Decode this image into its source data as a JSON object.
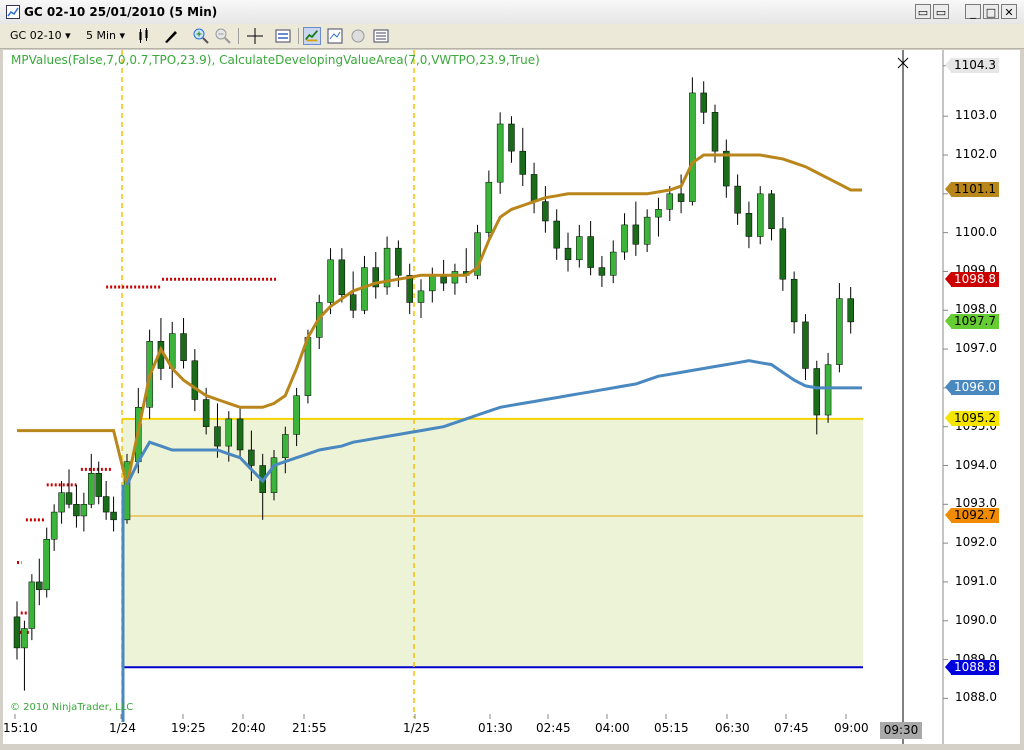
{
  "window": {
    "title": "GC 02-10  25/01/2010 (5 Min)",
    "buttons": [
      "▭",
      "▭",
      "_",
      "□",
      "✕"
    ]
  },
  "toolbar": {
    "instrument": "GC 02-10",
    "interval": "5 Min",
    "icons": [
      "bar-style-icon",
      "draw-tool-icon",
      "zoom-in-icon",
      "zoom-out-icon",
      "crosshair-icon",
      "properties-icon",
      "data-box-icon",
      "strategy-icon",
      "chart-trader-icon",
      "alert-icon",
      "chart-options-icon"
    ]
  },
  "chart": {
    "indicator_label": "MPValues(False,7,0,0.7,TPO,23.9), CalculateDevelopingValueArea(7,0,VWTPO,23.9,True)",
    "copyright": "© 2010 NinjaTrader, LLC",
    "crosshair_time": "09:30",
    "colors": {
      "up_candle": "#3cb43c",
      "down_candle": "#1a6b1a",
      "vwap": "#b8861a",
      "poc": "#4a88c0",
      "value_area_fill": "#edf3d6",
      "value_area_high": "#f5d200",
      "mid_line": "#e8a000",
      "low_line": "#0000cc",
      "session_divider": "#f5c000",
      "level_dots": "#cc0000"
    }
  },
  "chart_data": {
    "type": "candlestick",
    "title": "GC 02-10 (5 Min)",
    "y_ticks": [
      "1104.3",
      "1103.0",
      "1102.0",
      "1101.0",
      "1100.0",
      "1099.0",
      "1098.0",
      "1097.0",
      "1096.0",
      "1095.0",
      "1094.0",
      "1093.0",
      "1092.0",
      "1091.0",
      "1090.0",
      "1089.0",
      "1088.0"
    ],
    "x_ticks": [
      "15:10",
      "1/24",
      "19:25",
      "20:40",
      "21:55",
      "1/25",
      "01:30",
      "02:45",
      "04:00",
      "05:15",
      "06:30",
      "07:45",
      "09:00"
    ],
    "ylim": [
      1087.7,
      1104.5
    ],
    "price_tags": [
      {
        "label": "1104.3",
        "value": 1104.3,
        "color": "#e6e6e6",
        "text": "#000000"
      },
      {
        "label": "1101.1",
        "value": 1101.1,
        "color": "#b8861a",
        "text": "#000000"
      },
      {
        "label": "1098.8",
        "value": 1098.8,
        "color": "#cc0000",
        "text": "#ffffff"
      },
      {
        "label": "1097.7",
        "value": 1097.7,
        "color": "#66cc33",
        "text": "#000000"
      },
      {
        "label": "1096.0",
        "value": 1096.0,
        "color": "#4a88c0",
        "text": "#ffffff"
      },
      {
        "label": "1095.2",
        "value": 1095.2,
        "color": "#f5e400",
        "text": "#000000"
      },
      {
        "label": "1092.7",
        "value": 1092.7,
        "color": "#f08a00",
        "text": "#000000"
      },
      {
        "label": "1088.8",
        "value": 1088.8,
        "color": "#0000dd",
        "text": "#ffffff"
      }
    ],
    "levels": {
      "value_area_high": 1095.2,
      "mid": 1092.7,
      "value_area_low": 1088.8
    },
    "candles": [
      [
        1090.1,
        1090.5,
        1089.0,
        1089.3
      ],
      [
        1089.3,
        1090.0,
        1088.2,
        1089.8
      ],
      [
        1089.8,
        1091.2,
        1089.5,
        1091.0
      ],
      [
        1091.0,
        1091.6,
        1090.4,
        1090.8
      ],
      [
        1090.8,
        1092.4,
        1090.6,
        1092.1
      ],
      [
        1092.1,
        1093.0,
        1091.8,
        1092.8
      ],
      [
        1092.8,
        1093.6,
        1092.5,
        1093.3
      ],
      [
        1093.3,
        1093.9,
        1092.9,
        1093.0
      ],
      [
        1093.0,
        1093.5,
        1092.4,
        1092.7
      ],
      [
        1092.7,
        1093.3,
        1092.3,
        1093.0
      ],
      [
        1093.0,
        1094.3,
        1092.9,
        1093.8
      ],
      [
        1093.8,
        1094.1,
        1093.0,
        1093.2
      ],
      [
        1093.2,
        1093.6,
        1092.6,
        1092.8
      ],
      [
        1092.8,
        1093.2,
        1092.3,
        1092.6
      ],
      [
        1092.6,
        1094.3,
        1092.5,
        1094.1
      ],
      [
        1094.1,
        1096.0,
        1093.8,
        1095.5
      ],
      [
        1095.5,
        1097.5,
        1095.2,
        1097.2
      ],
      [
        1097.2,
        1097.8,
        1096.2,
        1096.5
      ],
      [
        1096.5,
        1097.7,
        1096.0,
        1097.4
      ],
      [
        1097.4,
        1097.8,
        1096.5,
        1096.7
      ],
      [
        1096.7,
        1097.0,
        1095.4,
        1095.7
      ],
      [
        1095.7,
        1096.0,
        1094.8,
        1095.0
      ],
      [
        1095.0,
        1095.6,
        1094.2,
        1094.5
      ],
      [
        1094.5,
        1095.4,
        1094.1,
        1095.2
      ],
      [
        1095.2,
        1095.5,
        1094.2,
        1094.4
      ],
      [
        1094.4,
        1094.9,
        1093.6,
        1094.0
      ],
      [
        1094.0,
        1094.3,
        1092.6,
        1093.3
      ],
      [
        1093.3,
        1094.4,
        1093.1,
        1094.2
      ],
      [
        1094.2,
        1095.0,
        1093.8,
        1094.8
      ],
      [
        1094.8,
        1096.0,
        1094.5,
        1095.8
      ],
      [
        1095.8,
        1097.5,
        1095.6,
        1097.3
      ],
      [
        1097.3,
        1098.4,
        1097.0,
        1098.2
      ],
      [
        1098.2,
        1099.6,
        1097.9,
        1099.3
      ],
      [
        1099.3,
        1099.6,
        1098.2,
        1098.4
      ],
      [
        1098.4,
        1099.0,
        1097.8,
        1098.0
      ],
      [
        1098.0,
        1099.4,
        1097.9,
        1099.1
      ],
      [
        1099.1,
        1099.5,
        1098.3,
        1098.6
      ],
      [
        1098.6,
        1099.9,
        1098.4,
        1099.6
      ],
      [
        1099.6,
        1099.8,
        1098.6,
        1098.9
      ],
      [
        1098.9,
        1099.2,
        1097.9,
        1098.2
      ],
      [
        1098.2,
        1098.8,
        1097.8,
        1098.5
      ],
      [
        1098.5,
        1099.1,
        1098.2,
        1098.9
      ],
      [
        1098.9,
        1099.3,
        1098.5,
        1098.7
      ],
      [
        1098.7,
        1099.2,
        1098.4,
        1099.0
      ],
      [
        1099.0,
        1099.6,
        1098.7,
        1098.9
      ],
      [
        1098.9,
        1100.2,
        1098.8,
        1100.0
      ],
      [
        1100.0,
        1101.6,
        1099.8,
        1101.3
      ],
      [
        1101.3,
        1103.1,
        1101.0,
        1102.8
      ],
      [
        1102.8,
        1103.0,
        1101.8,
        1102.1
      ],
      [
        1102.1,
        1102.7,
        1101.2,
        1101.5
      ],
      [
        1101.5,
        1101.8,
        1100.5,
        1100.8
      ],
      [
        1100.8,
        1101.2,
        1100.0,
        1100.3
      ],
      [
        1100.3,
        1100.6,
        1099.3,
        1099.6
      ],
      [
        1099.6,
        1100.0,
        1099.0,
        1099.3
      ],
      [
        1099.3,
        1100.2,
        1099.1,
        1099.9
      ],
      [
        1099.9,
        1100.3,
        1098.9,
        1099.1
      ],
      [
        1099.1,
        1099.4,
        1098.6,
        1098.9
      ],
      [
        1098.9,
        1099.8,
        1098.7,
        1099.5
      ],
      [
        1099.5,
        1100.5,
        1099.3,
        1100.2
      ],
      [
        1100.2,
        1100.8,
        1099.4,
        1099.7
      ],
      [
        1099.7,
        1100.6,
        1099.5,
        1100.4
      ],
      [
        1100.4,
        1100.9,
        1099.9,
        1100.6
      ],
      [
        1100.6,
        1101.2,
        1100.3,
        1101.0
      ],
      [
        1101.0,
        1101.5,
        1100.5,
        1100.8
      ],
      [
        1100.8,
        1104.0,
        1100.7,
        1103.6
      ],
      [
        1103.6,
        1103.9,
        1102.8,
        1103.1
      ],
      [
        1103.1,
        1103.3,
        1101.8,
        1102.1
      ],
      [
        1102.1,
        1102.4,
        1100.9,
        1101.2
      ],
      [
        1101.2,
        1101.5,
        1100.2,
        1100.5
      ],
      [
        1100.5,
        1100.8,
        1099.6,
        1099.9
      ],
      [
        1099.9,
        1101.2,
        1099.7,
        1101.0
      ],
      [
        1101.0,
        1101.1,
        1099.8,
        1100.1
      ],
      [
        1100.1,
        1100.4,
        1098.5,
        1098.8
      ],
      [
        1098.8,
        1099.0,
        1097.4,
        1097.7
      ],
      [
        1097.7,
        1097.9,
        1096.2,
        1096.5
      ],
      [
        1096.5,
        1096.7,
        1094.8,
        1095.3
      ],
      [
        1095.3,
        1096.9,
        1095.1,
        1096.6
      ],
      [
        1096.6,
        1098.7,
        1096.4,
        1098.3
      ],
      [
        1098.3,
        1098.6,
        1097.4,
        1097.7
      ]
    ],
    "series": [
      {
        "name": "VWTPO value line",
        "values": [
          1094.9,
          1094.9,
          1094.9,
          1094.9,
          1094.9,
          1094.9,
          1094.9,
          1094.9,
          1094.9,
          1094.9,
          1094.9,
          1094.9,
          1094.9,
          1094.9,
          1093.5,
          1094.9,
          1096.3,
          1097.0,
          1096.5,
          1096.2,
          1096.0,
          1095.8,
          1095.7,
          1095.6,
          1095.5,
          1095.5,
          1095.5,
          1095.6,
          1095.8,
          1096.5,
          1097.3,
          1097.8,
          1098.1,
          1098.3,
          1098.5,
          1098.6,
          1098.7,
          1098.75,
          1098.8,
          1098.85,
          1098.9,
          1098.9,
          1098.9,
          1098.9,
          1098.9,
          1099.1,
          1099.8,
          1100.4,
          1100.6,
          1100.7,
          1100.8,
          1100.9,
          1100.95,
          1101.0,
          1101.0,
          1101.0,
          1101.0,
          1101.0,
          1101.0,
          1101.0,
          1101.0,
          1101.05,
          1101.1,
          1101.2,
          1101.8,
          1102.0,
          1102.0,
          1102.0,
          1102.0,
          1102.0,
          1102.0,
          1101.95,
          1101.9,
          1101.8,
          1101.7,
          1101.55,
          1101.4,
          1101.25,
          1101.1,
          1101.1
        ]
      },
      {
        "name": "Developing POC",
        "values": [
          null,
          null,
          null,
          null,
          null,
          null,
          null,
          null,
          null,
          null,
          null,
          null,
          null,
          null,
          1093.5,
          1094.1,
          1094.6,
          1094.5,
          1094.4,
          1094.4,
          1094.4,
          1094.4,
          1094.4,
          1094.3,
          1094.2,
          1093.9,
          1093.6,
          1094.0,
          1094.1,
          1094.2,
          1094.3,
          1094.4,
          1094.45,
          1094.5,
          1094.6,
          1094.65,
          1094.7,
          1094.75,
          1094.8,
          1094.85,
          1094.9,
          1094.95,
          1095.0,
          1095.1,
          1095.2,
          1095.3,
          1095.4,
          1095.5,
          1095.55,
          1095.6,
          1095.65,
          1095.7,
          1095.75,
          1095.8,
          1095.85,
          1095.9,
          1095.95,
          1096.0,
          1096.05,
          1096.1,
          1096.2,
          1096.3,
          1096.35,
          1096.4,
          1096.45,
          1096.5,
          1096.55,
          1096.6,
          1096.65,
          1096.7,
          1096.65,
          1096.6,
          1096.4,
          1096.2,
          1096.05,
          1096.0,
          1096.0,
          1096.0,
          1096.0,
          1096.0
        ]
      }
    ],
    "dotted_levels": [
      {
        "from": 0,
        "to": 0.6,
        "value": 1091.5
      },
      {
        "from": 0.5,
        "to": 1.7,
        "value": 1090.2
      },
      {
        "from": 0.3,
        "to": 1.6,
        "value": 1089.7
      },
      {
        "from": 1.2,
        "to": 3.8,
        "value": 1092.6
      },
      {
        "from": 4.0,
        "to": 8.0,
        "value": 1093.5
      },
      {
        "from": 8.6,
        "to": 12.8,
        "value": 1093.9
      },
      {
        "from": 12.0,
        "to": 17.1,
        "value": 1098.6
      },
      {
        "from": 17.1,
        "to": 27.2,
        "value": 1098.8
      }
    ]
  }
}
